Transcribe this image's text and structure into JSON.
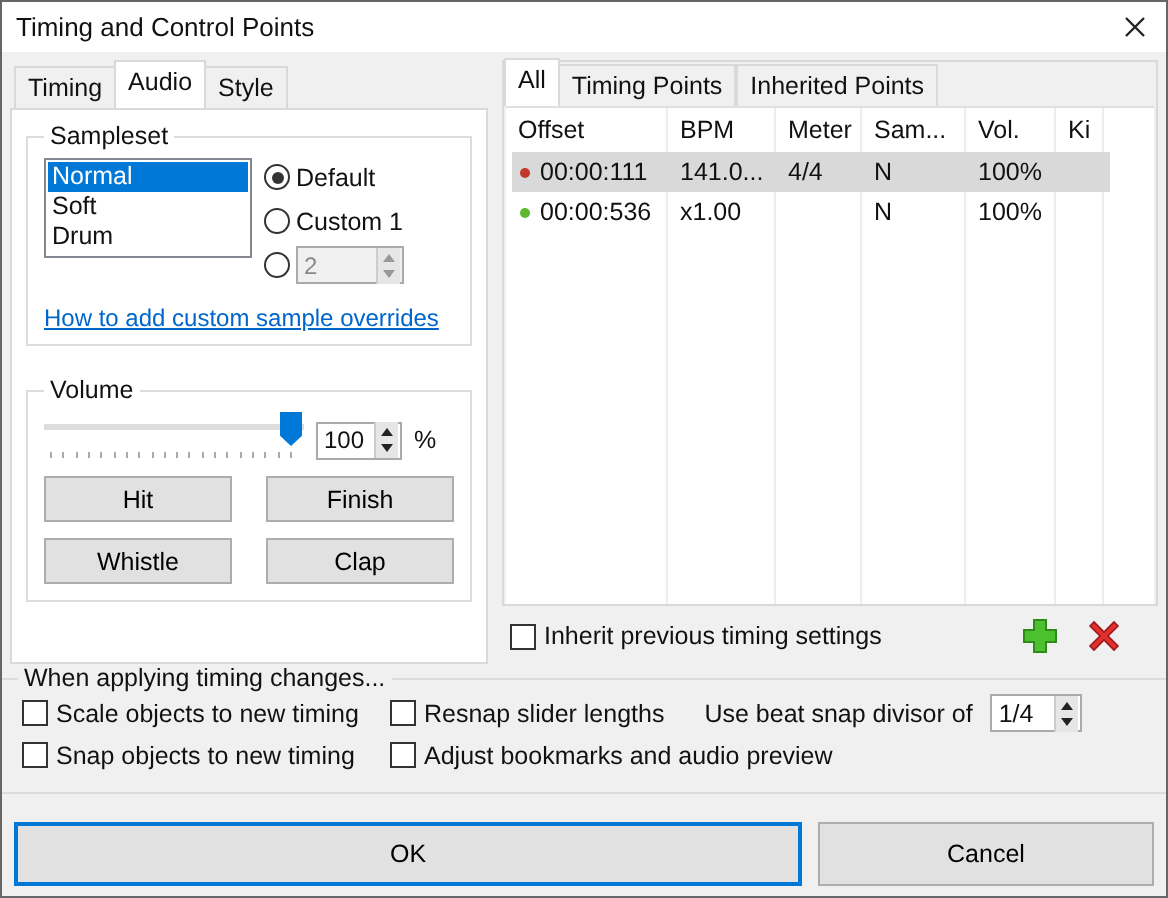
{
  "window": {
    "title": "Timing and Control Points"
  },
  "left_tabs": [
    {
      "label": "Timing",
      "selected": false
    },
    {
      "label": "Audio",
      "selected": true
    },
    {
      "label": "Style",
      "selected": false
    }
  ],
  "sampleset": {
    "title": "Sampleset",
    "items": [
      {
        "label": "Normal",
        "selected": true
      },
      {
        "label": "Soft",
        "selected": false
      },
      {
        "label": "Drum",
        "selected": false
      }
    ],
    "radios": [
      {
        "kind": "label",
        "label": "Default",
        "selected": true
      },
      {
        "kind": "label",
        "label": "Custom 1",
        "selected": false
      },
      {
        "kind": "spin",
        "value": "2",
        "disabled": true,
        "selected": false
      }
    ],
    "link": "How to add custom sample overrides"
  },
  "volume": {
    "title": "Volume",
    "level": 1,
    "value": "100",
    "unit": "%",
    "buttons": [
      "Hit",
      "Finish",
      "Whistle",
      "Clap"
    ]
  },
  "right_tabs": [
    {
      "label": "All",
      "selected": true
    },
    {
      "label": "Timing Points",
      "selected": false
    },
    {
      "label": "Inherited Points",
      "selected": false
    }
  ],
  "table": {
    "columns": [
      "Offset",
      "BPM",
      "Meter",
      "Sam...",
      "Vol.",
      "Ki"
    ],
    "rows": [
      {
        "color": "#c0392b",
        "cells": [
          "00:00:111",
          "141.0...",
          "4/4",
          "N",
          "100%"
        ],
        "selected": true
      },
      {
        "color": "#5cb82e",
        "cells": [
          "00:00:536",
          "x1.00",
          "",
          "N",
          "100%"
        ],
        "selected": false
      }
    ]
  },
  "inherit": {
    "label": "Inherit previous timing settings",
    "checked": false
  },
  "changes": {
    "title": "When applying timing changes...",
    "options": [
      {
        "label": "Scale objects to new timing",
        "checked": false
      },
      {
        "label": "Resnap slider lengths",
        "checked": false
      },
      {
        "label": "Snap objects to new timing",
        "checked": false
      },
      {
        "label": "Adjust bookmarks and audio preview",
        "checked": false
      }
    ],
    "snap_label": "Use beat snap divisor of",
    "snap_value": "1/4"
  },
  "buttons": [
    {
      "label": "OK",
      "default": true
    },
    {
      "label": "Cancel",
      "default": false
    }
  ]
}
